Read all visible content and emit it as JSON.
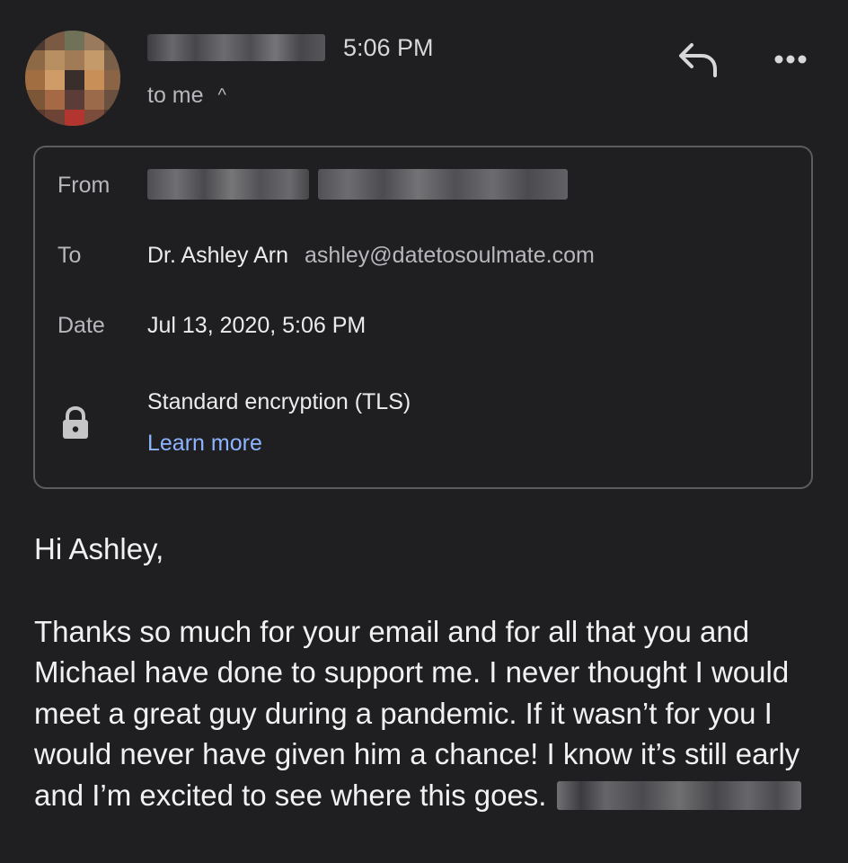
{
  "header": {
    "time": "5:06 PM",
    "to_me": "to me",
    "expand_icon": "chevron-up-icon",
    "reply_icon": "reply-icon",
    "more_icon": "more-horizontal-icon"
  },
  "details": {
    "from_label": "From",
    "to_label": "To",
    "to_name": "Dr. Ashley Arn",
    "to_email": "ashley@datetosoulmate.com",
    "date_label": "Date",
    "date_value": "Jul 13, 2020, 5:06 PM",
    "encryption": "Standard encryption (TLS)",
    "learn_more": "Learn more",
    "lock_icon": "lock-icon"
  },
  "message": {
    "greeting": "Hi Ashley,",
    "body": "Thanks so much for your email and for all that you and Michael have done to support me. I never thought I would meet a great guy during a pandemic. If it wasn’t for you I would never have given him a chance! I know it’s still early and I’m excited to see where this goes."
  },
  "colors": {
    "background": "#1f1f22",
    "border": "#5b5b60",
    "link": "#8db4ff",
    "text_primary": "#ececee",
    "text_secondary": "#b8b8bc"
  }
}
